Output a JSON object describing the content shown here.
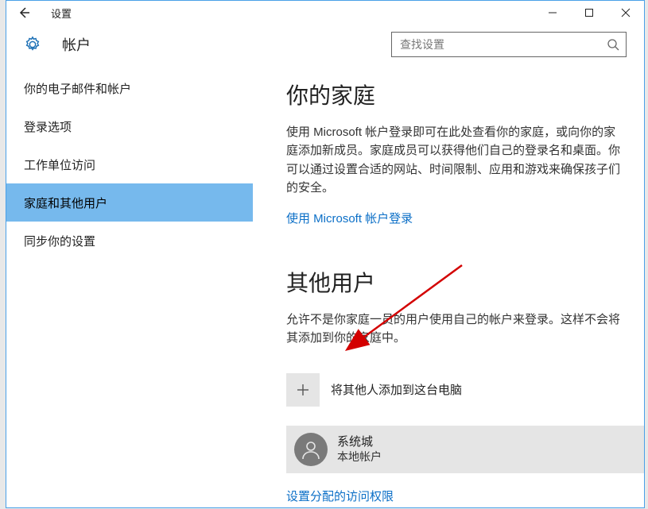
{
  "window": {
    "title": "设置"
  },
  "header": {
    "title": "帐户"
  },
  "search": {
    "placeholder": "查找设置"
  },
  "sidebar": {
    "items": [
      {
        "label": "你的电子邮件和帐户"
      },
      {
        "label": "登录选项"
      },
      {
        "label": "工作单位访问"
      },
      {
        "label": "家庭和其他用户"
      },
      {
        "label": "同步你的设置"
      }
    ],
    "selected_index": 3
  },
  "family": {
    "heading": "你的家庭",
    "desc": "使用 Microsoft 帐户登录即可在此处查看你的家庭，或向你的家庭添加新成员。家庭成员可以获得他们自己的登录名和桌面。你可以通过设置合适的网站、时间限制、应用和游戏来确保孩子们的安全。",
    "link": "使用 Microsoft 帐户登录"
  },
  "others": {
    "heading": "其他用户",
    "desc": "允许不是你家庭一员的用户使用自己的帐户来登录。这样不会将其添加到你的家庭中。",
    "add_label": "将其他人添加到这台电脑",
    "user_name": "系统城",
    "user_sub": "本地帐户",
    "access_link": "设置分配的访问权限"
  }
}
